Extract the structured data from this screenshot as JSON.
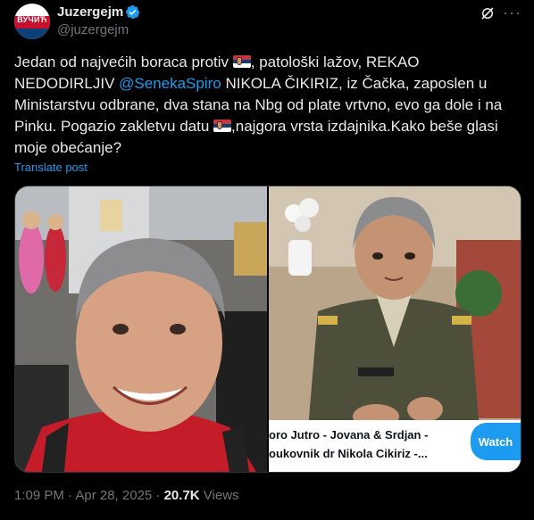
{
  "author": {
    "display_name": "Juzergejm",
    "handle": "@juzergejm",
    "avatar_text": "ВУЧИЋ"
  },
  "post": {
    "seg1": "Jedan od najvećih boraca protiv ",
    "seg2": ", patološki lažov, REKAO NEDODIRLJIV ",
    "mention": "@SenekaSpiro",
    "seg3": " NIKOLA ČIKIRIZ, iz Čačka, zaposlen u Ministarstvu odbrane, dva stana na Nbg od plate vrtvno, evo ga dole i na Pinku. Pogazio zakletvu datu ",
    "seg4": ",najgora vrsta izdajnika.Kako beše glasi moje obećanje?",
    "translate": "Translate post"
  },
  "video": {
    "caption_line1": "oro Jutro - Jovana & Srdjan -",
    "caption_line2": "oukovnik dr Nikola Cikiriz -...",
    "watch_label": "Watch"
  },
  "meta": {
    "time": "1:09 PM · Apr 28, 2025 · ",
    "views_count": "20.7K",
    "views_label": " Views"
  },
  "colors": {
    "accent": "#1d9bf0",
    "background": "#000000",
    "text": "#e7e9ea",
    "muted": "#71767b"
  }
}
